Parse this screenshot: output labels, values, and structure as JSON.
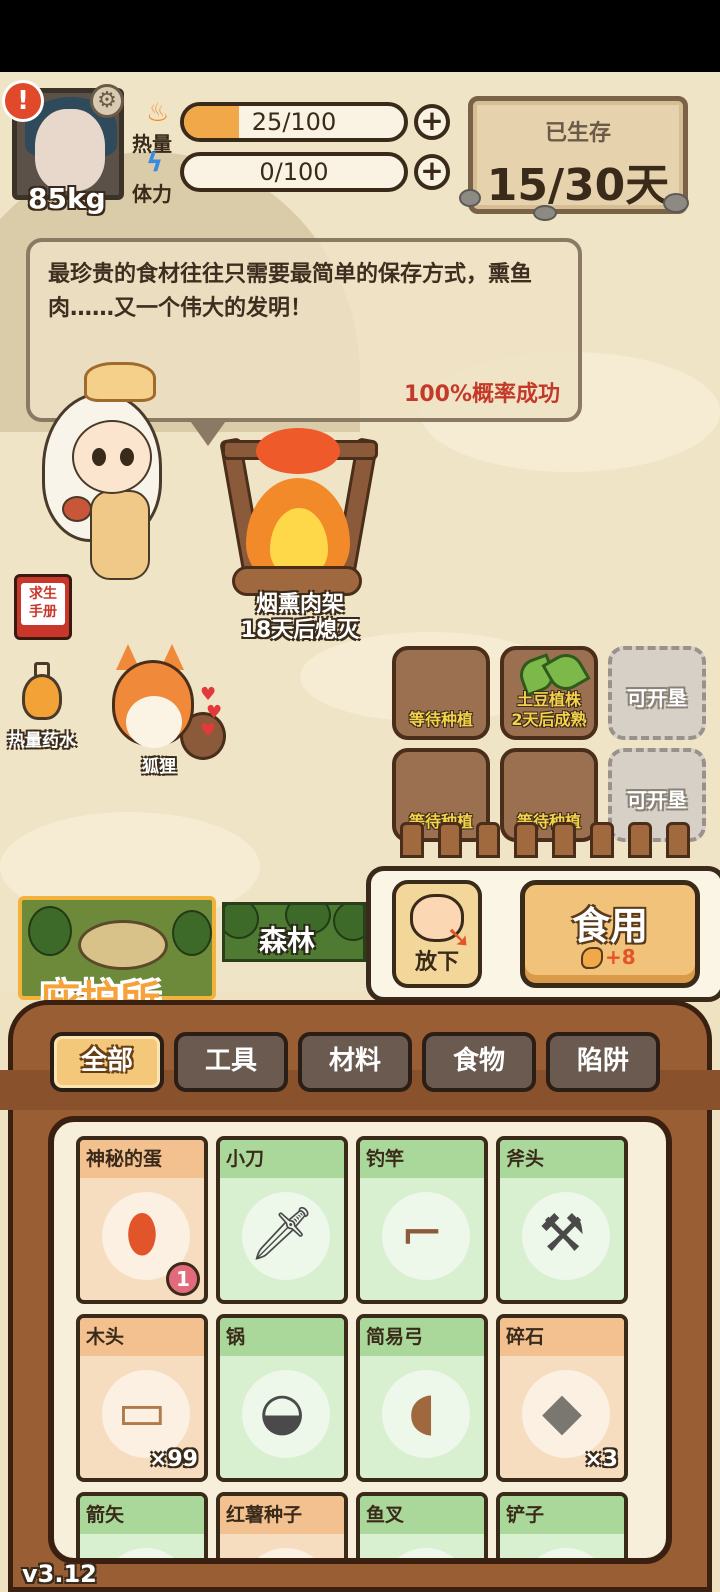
{
  "player": {
    "weight": "85kg",
    "alert_symbol": "!",
    "settings_icon": "gear-icon"
  },
  "stats": {
    "calories": {
      "label": "热量",
      "value_text": "25/100",
      "progress": 0.25,
      "icon": "fire-icon"
    },
    "stamina": {
      "label": "体力",
      "value_text": "0/100",
      "progress": 0.0,
      "icon": "lightning-icon"
    }
  },
  "survival": {
    "label": "已生存",
    "days": "15/30天"
  },
  "dialogue": {
    "text": "最珍贵的食材往往只需要最简单的保存方式，熏鱼肉……又一个伟大的发明！",
    "success_rate": "100%概率成功"
  },
  "campfire": {
    "name": "烟熏肉架",
    "status": "18天后熄灭"
  },
  "side_items": {
    "manual": "求生手册",
    "potion": "热量药水",
    "pet": "狐狸"
  },
  "farm": {
    "plots": [
      {
        "text": "等待种植",
        "state": "empty"
      },
      {
        "text": "土豆植株\n2天后成熟",
        "state": "growing"
      },
      {
        "text": "可开垦",
        "state": "locked"
      },
      {
        "text": "等待种植",
        "state": "empty"
      },
      {
        "text": "等待种植",
        "state": "empty"
      },
      {
        "text": "可开垦",
        "state": "locked"
      }
    ]
  },
  "locations": {
    "current": "庇护所",
    "next": "森林"
  },
  "actions": {
    "drop_label": "放下",
    "eat_label": "食用",
    "eat_bonus": "+8"
  },
  "tabs": [
    "全部",
    "工具",
    "材料",
    "食物",
    "陷阱"
  ],
  "active_tab": 0,
  "items": [
    {
      "name": "神秘的蛋",
      "icon": "egg-icon",
      "style": "orange",
      "count": "",
      "badge": "1"
    },
    {
      "name": "小刀",
      "icon": "knife-icon",
      "style": "green",
      "count": "",
      "badge": ""
    },
    {
      "name": "钓竿",
      "icon": "fishing-rod-icon",
      "style": "green",
      "count": "",
      "badge": ""
    },
    {
      "name": "斧头",
      "icon": "axe-icon",
      "style": "green",
      "count": "",
      "badge": ""
    },
    {
      "name": "木头",
      "icon": "wood-log-icon",
      "style": "orange",
      "count": "×99",
      "badge": ""
    },
    {
      "name": "锅",
      "icon": "pot-icon",
      "style": "green",
      "count": "",
      "badge": ""
    },
    {
      "name": "简易弓",
      "icon": "bow-icon",
      "style": "green",
      "count": "",
      "badge": ""
    },
    {
      "name": "碎石",
      "icon": "stone-icon",
      "style": "orange",
      "count": "×3",
      "badge": ""
    },
    {
      "name": "箭矢",
      "icon": "arrow-icon",
      "style": "green",
      "count": "",
      "badge": ""
    },
    {
      "name": "红薯种子",
      "icon": "seed-icon",
      "style": "orange",
      "count": "",
      "badge": ""
    },
    {
      "name": "鱼叉",
      "icon": "harpoon-icon",
      "style": "green",
      "count": "",
      "badge": ""
    },
    {
      "name": "铲子",
      "icon": "shovel-icon",
      "style": "green",
      "count": "",
      "badge": ""
    }
  ],
  "version": "v3.12"
}
